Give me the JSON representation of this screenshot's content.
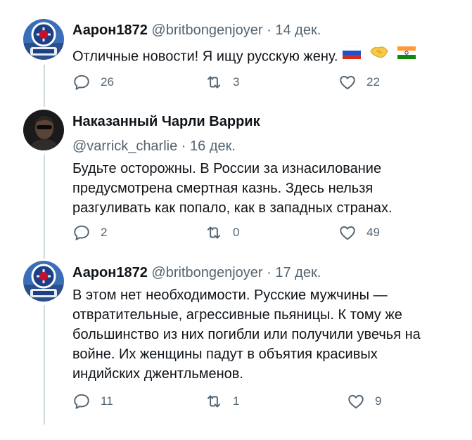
{
  "tweets": [
    {
      "display_name": "Аарон1872",
      "handle": "@britbongenjoyer",
      "dot": "·",
      "date": "14 дек.",
      "text": "Отличные новости! Я ищу русскую жену.",
      "emojis": [
        "flag-russia-icon",
        "handshake-icon",
        "flag-india-icon"
      ],
      "replies": "26",
      "retweets": "3",
      "likes": "22"
    },
    {
      "display_name": "Наказанный Чарли Варрик",
      "handle": "@varrick_charlie",
      "dot": "·",
      "date": "16 дек.",
      "text_lines": [
        "Будьте осторожны. В России за изнасилование",
        "предусмотрена смертная казнь. Здесь нельзя",
        "разгуливать как попало, как в западных странах."
      ],
      "replies": "2",
      "retweets": "0",
      "likes": "49"
    },
    {
      "display_name": "Аарон1872",
      "handle": "@britbongenjoyer",
      "dot": "·",
      "date": "17 дек.",
      "text_lines": [
        "В этом нет необходимости. Русские мужчины —",
        "отвратительные, агрессивные пьяницы. К тому же",
        "большинство из них погибли или получили увечья на",
        "войне. Их женщины падут в объятия красивых",
        "индийских джентльменов."
      ],
      "replies": "11",
      "retweets": "1",
      "likes": "9"
    }
  ],
  "colors": {
    "text": "#0f1419",
    "secondary": "#536471",
    "thread_line": "#cfd9de"
  }
}
